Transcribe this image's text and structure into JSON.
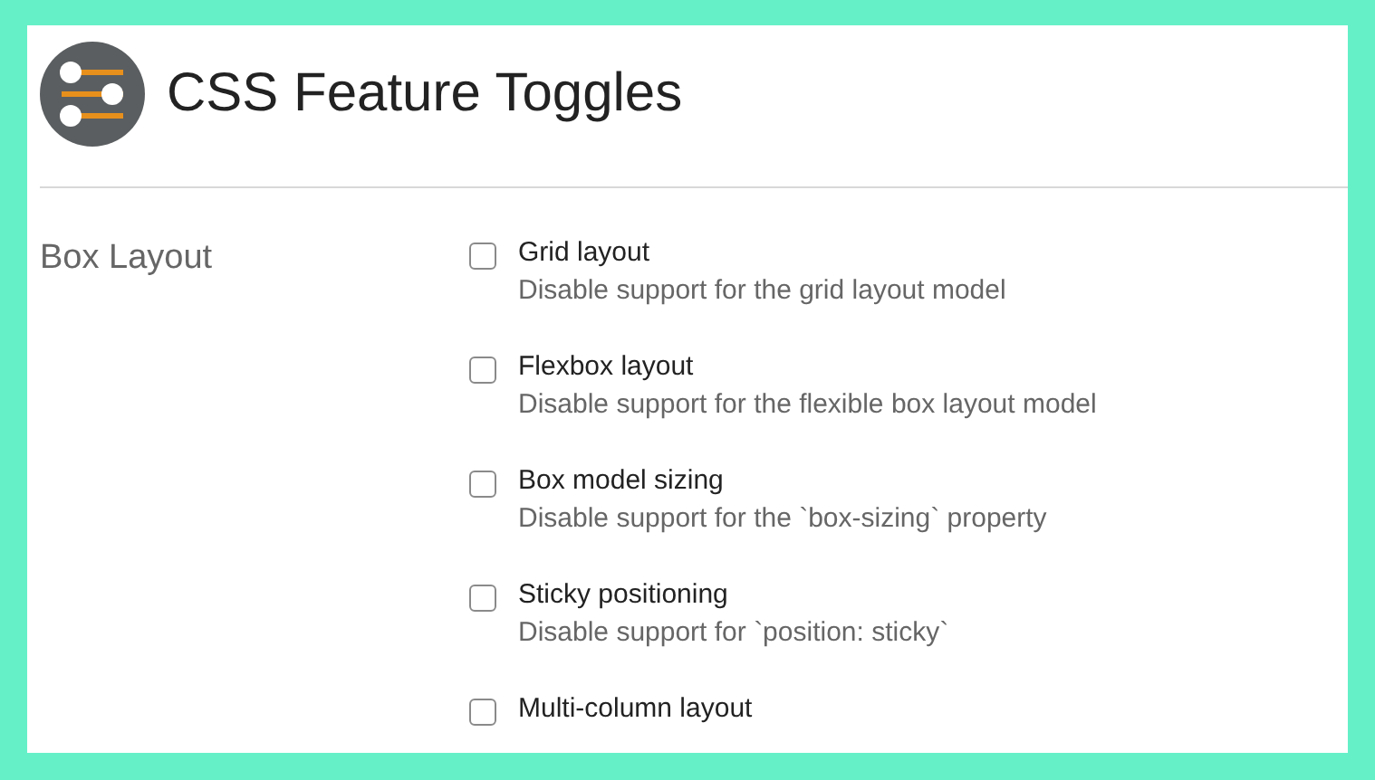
{
  "header": {
    "title": "CSS Feature Toggles"
  },
  "sections": [
    {
      "label": "Box Layout",
      "options": [
        {
          "label": "Grid layout",
          "description": "Disable support for the grid layout model",
          "checked": false
        },
        {
          "label": "Flexbox layout",
          "description": "Disable support for the flexible box layout model",
          "checked": false
        },
        {
          "label": "Box model sizing",
          "description": "Disable support for the `box-sizing` property",
          "checked": false
        },
        {
          "label": "Sticky positioning",
          "description": "Disable support for `position: sticky`",
          "checked": false
        },
        {
          "label": "Multi-column layout",
          "checked": false
        }
      ]
    }
  ]
}
